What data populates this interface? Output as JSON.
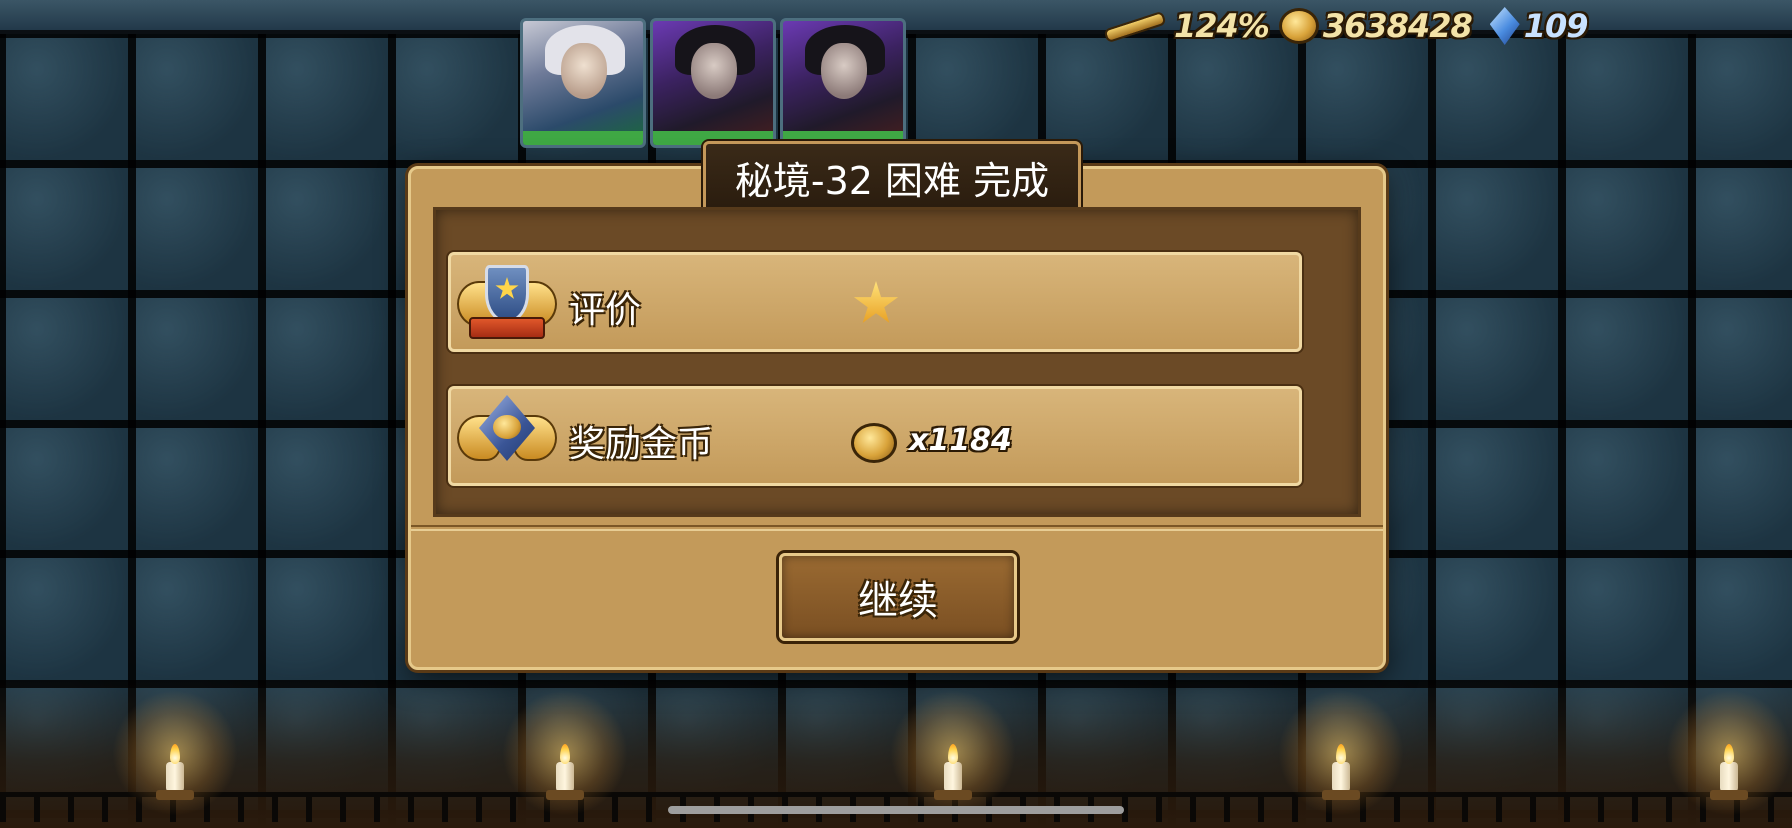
{
  "resources": {
    "spyglass_icon": "spyglass-icon",
    "percent": "124%",
    "gold_icon": "gold-coin-icon",
    "gold": "3638428",
    "gem_icon": "blue-gem-icon",
    "gems": "109"
  },
  "heroes": [
    {
      "icon": "hero-portrait-elf"
    },
    {
      "icon": "hero-portrait-archer"
    },
    {
      "icon": "hero-portrait-archer"
    }
  ],
  "dialog": {
    "title": "秘境-32 困难 完成",
    "rating": {
      "label": "评价",
      "stars": 1,
      "icon": "winged-shield-emblem-icon"
    },
    "reward": {
      "label": "奖励金币",
      "amount": "x1184",
      "icon": "coin-medal-emblem-icon"
    },
    "continue_label": "继续"
  },
  "colors": {
    "panel": "#c39a5a",
    "panel_inner": "#6b4a26",
    "title_plate": "#2a1c0e",
    "text": "#ffffff"
  }
}
